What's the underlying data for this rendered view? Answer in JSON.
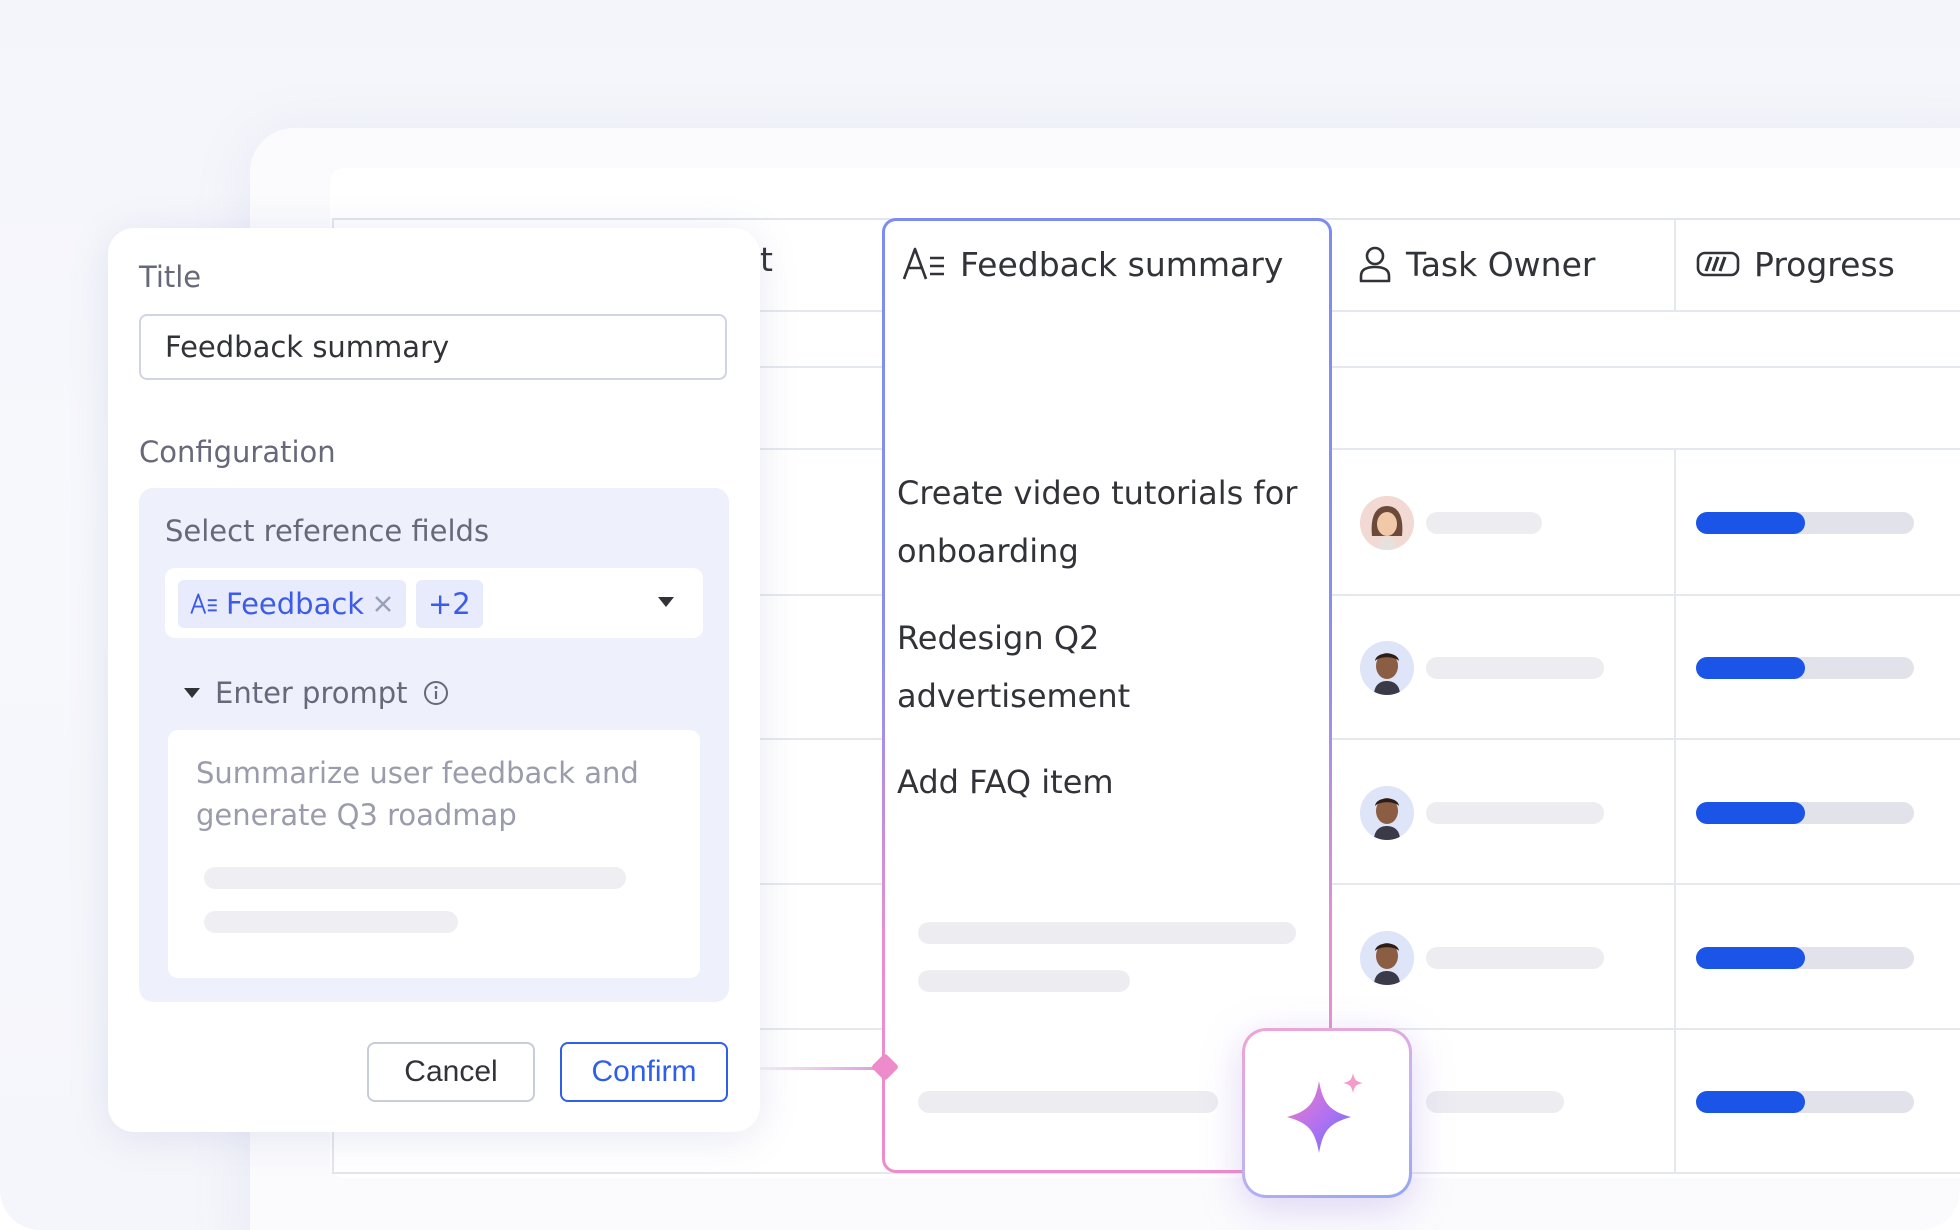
{
  "panel": {
    "title_label": "Title",
    "title_value": "Feedback summary",
    "configuration_label": "Configuration",
    "reference_fields_label": "Select reference fields",
    "chip_label": "Feedback",
    "chip_more": "+2",
    "prompt_toggle_label": "Enter prompt",
    "prompt_text": "Summarize user feedback and generate Q3 roadmap",
    "cancel_label": "Cancel",
    "confirm_label": "Confirm"
  },
  "board": {
    "partial_header": "t",
    "columns": {
      "feedback_summary": "Feedback summary",
      "task_owner": "Task Owner",
      "progress": "Progress"
    },
    "rows": [
      {
        "summary": "Create video tutorials for onboarding",
        "progress": 0.5
      },
      {
        "summary": "Redesign Q2 advertisement",
        "progress": 0.5
      },
      {
        "summary": "Add FAQ item",
        "progress": 0.5
      },
      {
        "summary": "",
        "progress": 0.5
      },
      {
        "summary": "",
        "progress": 0.5
      }
    ]
  },
  "colors": {
    "accent": "#2f5fe9",
    "progress_fill": "#1b55e8",
    "chip_text": "#3d5be9"
  }
}
